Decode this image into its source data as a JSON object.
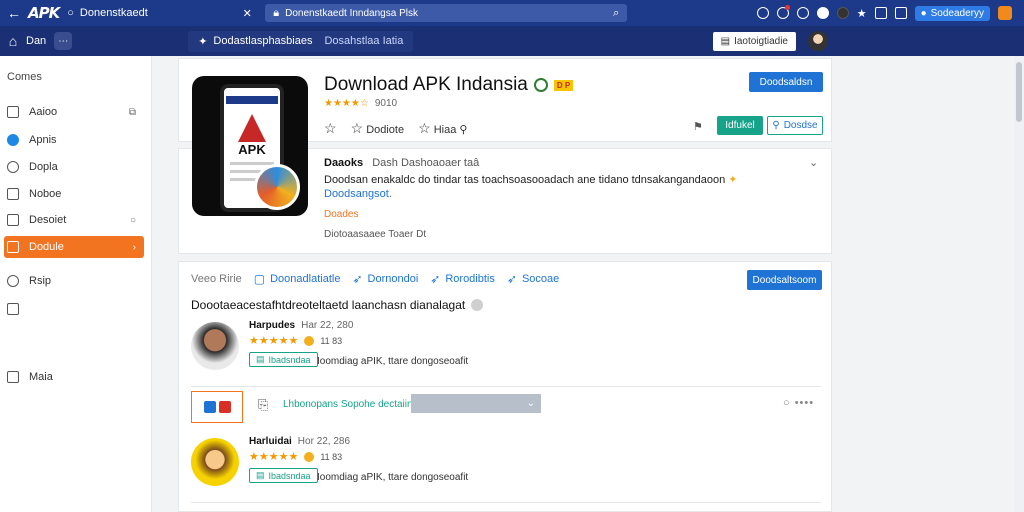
{
  "browser": {
    "logo": "APK",
    "tab_title": "Donenstkaedt",
    "url": "Donenstkaedt Inndangsa Plsk",
    "signin_label": "Sodeaderyy"
  },
  "nav": {
    "home_label": "Dan",
    "center_primary": "Dodastlasphasbiaes",
    "center_secondary": "Dosahstlaa Iatia",
    "right_button": "Iaotoigtiadie"
  },
  "sidebar": {
    "header": "Comes",
    "items": [
      {
        "label": "Aaioo",
        "trail": "⧉"
      },
      {
        "label": "Apnis",
        "trail": ""
      },
      {
        "label": "Dopla",
        "trail": ""
      },
      {
        "label": "Noboe",
        "trail": ""
      },
      {
        "label": "Desoiet",
        "trail": "○"
      },
      {
        "label": "Dodule",
        "trail": "›"
      },
      {
        "label": "Rsip",
        "trail": ""
      },
      {
        "label": "",
        "trail": ""
      },
      {
        "label": "Maia",
        "trail": ""
      }
    ],
    "active_index": 5
  },
  "app": {
    "title": "Download APK Indansia",
    "tag": "D P",
    "rating_stars": "★★★★☆",
    "rating_count": "9010",
    "action_1": "Dodiote",
    "action_2": "Hiaa",
    "btn_top": "Doodsaldsn",
    "btn_install": "Idfukel",
    "btn_share": "Dosdse"
  },
  "description": {
    "title": "Daaoks",
    "subtitle": "Dash Dashoaoaer taâ",
    "body": "Doodsan enakaldc do tindar tas toachsoasooadach ane tidano tdnsakangandaoon",
    "link": "Doodsangsot.",
    "orange": "Doades",
    "foot": "Diotoaasaaee Toaer Dt"
  },
  "reviews": {
    "label": "Veeo Ririe",
    "tabs": [
      "Doonadlatiatle",
      "Dornondoi",
      "Rorodibtis",
      "Socoae"
    ],
    "btn": "Doodsaltsoom",
    "headline": "Doootaeacestafhtdreoteltaetd laanchasn dianalagat",
    "items": [
      {
        "name": "Harpudes",
        "date": "Har 22, 280",
        "stars": "★★★★★",
        "count": "11 83",
        "badge": "Ibadsndaa",
        "text": "Ioomdiag aPIK, ttare dongoseoafit"
      },
      {
        "name": "Harluidai",
        "date": "Hor 22, 286",
        "stars": "★★★★★",
        "count": "11 83",
        "badge": "Ibadsndaa",
        "text": "Ioomdiag aPIK, ttare dongoseoafit"
      }
    ],
    "mid_text": "Lhbonopans Sopohe dectaiina",
    "more": "○ ••••"
  },
  "colors": {
    "topbar": "#1d3a8a",
    "navbar": "#1a2f74",
    "accent_orange": "#f27420",
    "accent_blue": "#1e73d4",
    "accent_green": "#16a38a",
    "star": "#f29900"
  }
}
